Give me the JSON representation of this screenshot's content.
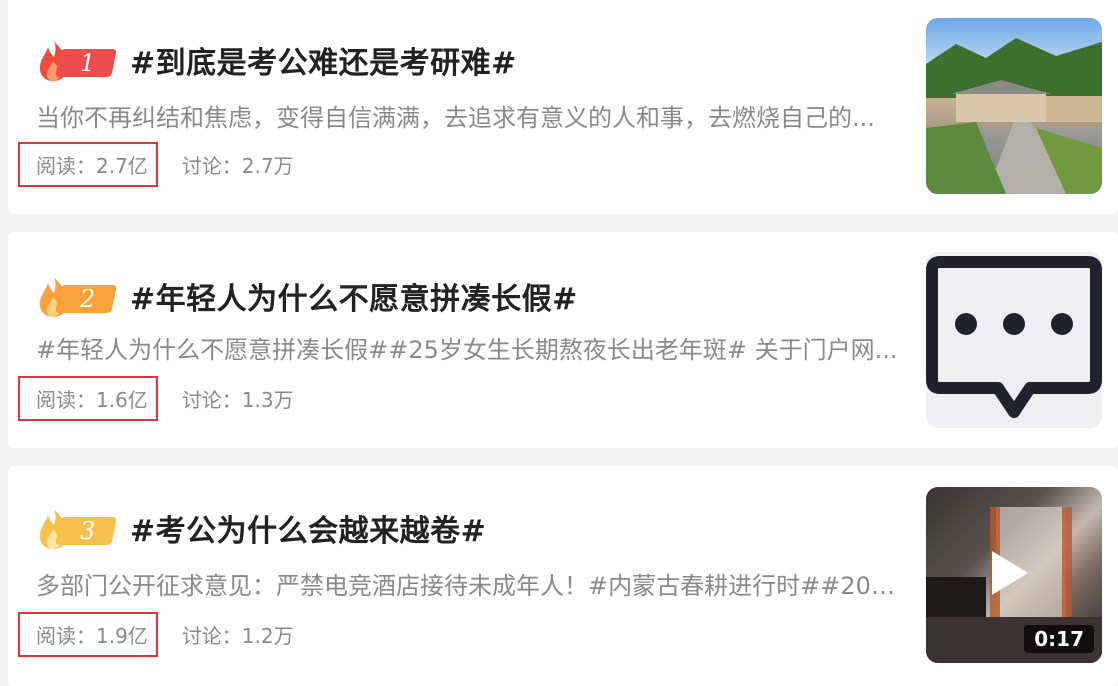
{
  "topics": [
    {
      "rank": "1",
      "rank_color": "#ef4d4d",
      "title": "#到底是考公难还是考研难#",
      "summary": "当你不再纠结和焦虑，变得自信满满，去追求有意义的人和事，去燃烧自己的...",
      "read": "阅读：2.7亿",
      "discuss": "讨论：2.7万",
      "thumb": "landscape-photo"
    },
    {
      "rank": "2",
      "rank_color": "#f7a23a",
      "title": "#年轻人为什么不愿意拼凑长假#",
      "summary": "#年轻人为什么不愿意拼凑长假##25岁女生长期熬夜长出老年斑# 关于门户网...",
      "read": "阅读：1.6亿",
      "discuss": "讨论：1.3万",
      "thumb": "chat-bubble-icon"
    },
    {
      "rank": "3",
      "rank_color": "#f6c04a",
      "title": "#考公为什么会越来越卷#",
      "summary": "多部门公开征求意见：严禁电竞酒店接待未成年人！#内蒙古春耕进行时##202...",
      "read": "阅读：1.9亿",
      "discuss": "讨论：1.2万",
      "thumb": "video-thumbnail",
      "duration": "0:17"
    }
  ],
  "colors": {
    "highlight_box": "#e0343a",
    "flame_red": "#f04a3a",
    "flame_orange": "#f7a23a",
    "flame_yellow": "#f6c04a"
  }
}
